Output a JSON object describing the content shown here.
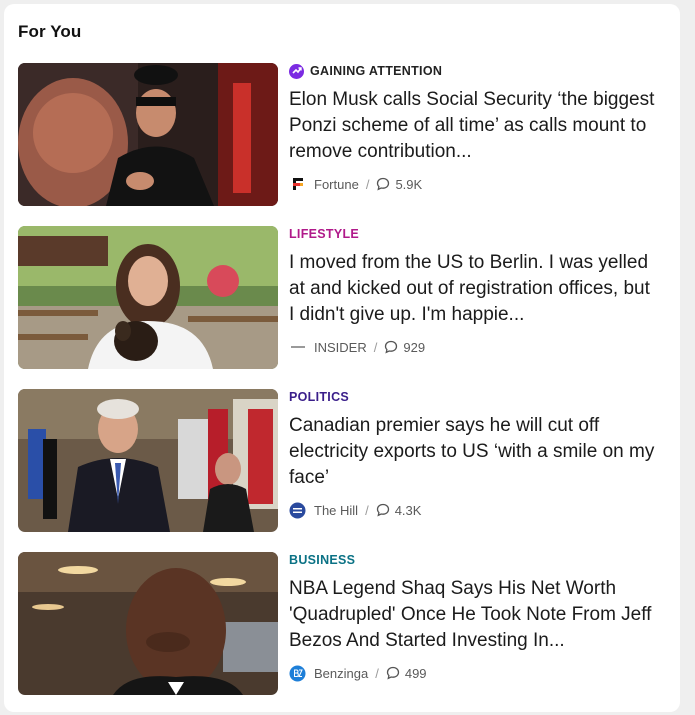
{
  "section": {
    "title": "For You"
  },
  "articles": [
    {
      "category": "GAINING ATTENTION",
      "category_color": "#222222",
      "category_icon": "trending-icon",
      "headline": "Elon Musk calls Social Security ‘the biggest Ponzi scheme of all time’ as calls mount to remove contribution...",
      "source": "Fortune",
      "comments": "5.9K"
    },
    {
      "category": "LIFESTYLE",
      "category_color": "#b0198a",
      "headline": "I moved from the US to Berlin. I was yelled at and kicked out of registration offices, but I didn't give up. I'm happie...",
      "source": "INSIDER",
      "comments": "929"
    },
    {
      "category": "POLITICS",
      "category_color": "#3a1e8a",
      "headline": "Canadian premier says he will cut off electricity exports to US ‘with a smile on my face’",
      "source": "The Hill",
      "comments": "4.3K"
    },
    {
      "category": "BUSINESS",
      "category_color": "#0b7285",
      "headline": "NBA Legend Shaq Says His Net Worth 'Quadrupled' Once He Took Note From Jeff Bezos And Started Investing In...",
      "source": "Benzinga",
      "comments": "499"
    }
  ]
}
